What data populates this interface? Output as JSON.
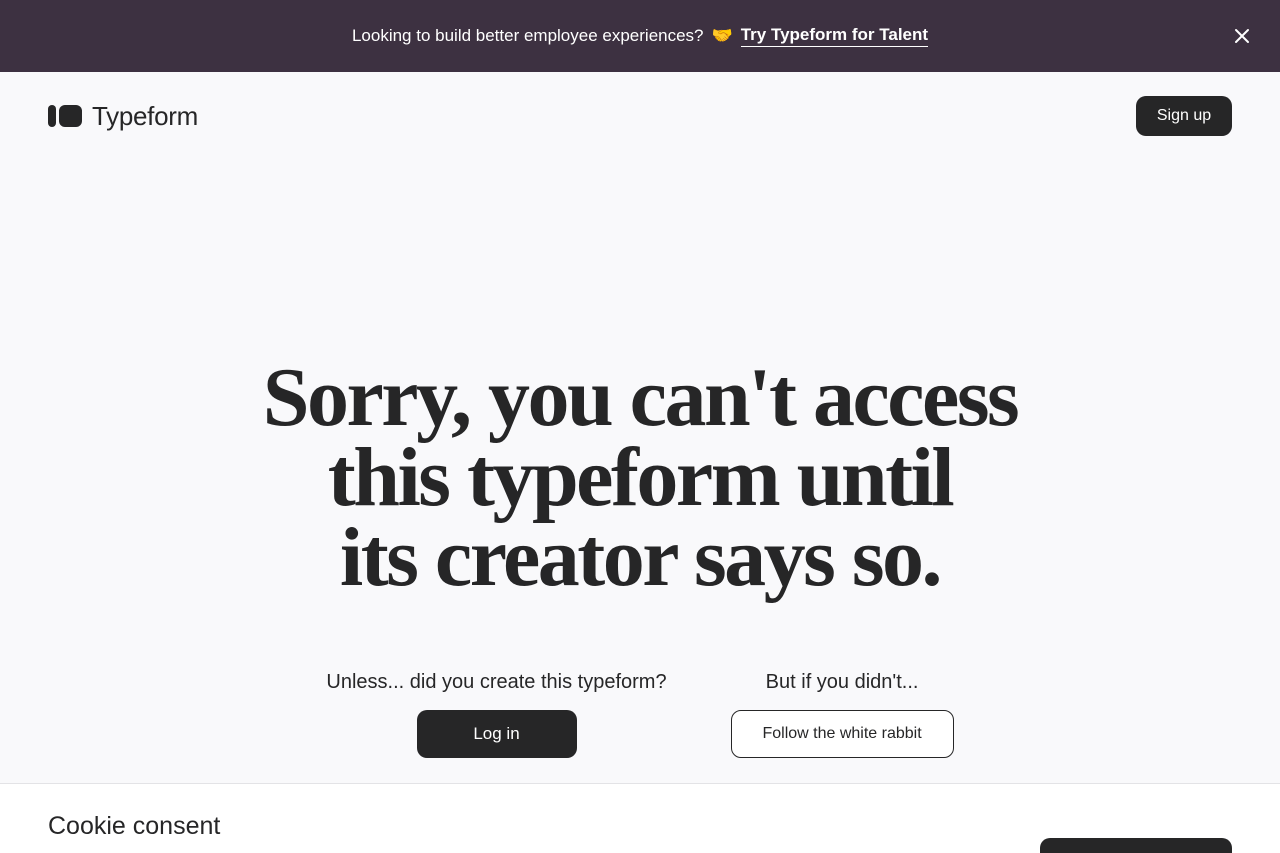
{
  "banner": {
    "text": "Looking to build better employee experiences?",
    "emoji": "🤝",
    "link": "Try Typeform for Talent",
    "close_icon": "close-icon"
  },
  "header": {
    "logo_text": "Typeform",
    "signup_label": "Sign up"
  },
  "headline": {
    "line1": "Sorry, you can't access",
    "line2": "this typeform until",
    "line3": "its creator says so."
  },
  "cta": {
    "left_prompt": "Unless... did you create this typeform?",
    "login_label": "Log in",
    "right_prompt": "But if you didn't...",
    "rabbit_label": "Follow the white rabbit"
  },
  "cookie": {
    "title": "Cookie consent"
  },
  "colors": {
    "banner_bg": "#3d3141",
    "page_bg": "#f9f9fb",
    "ink": "#262627",
    "white": "#ffffff"
  }
}
